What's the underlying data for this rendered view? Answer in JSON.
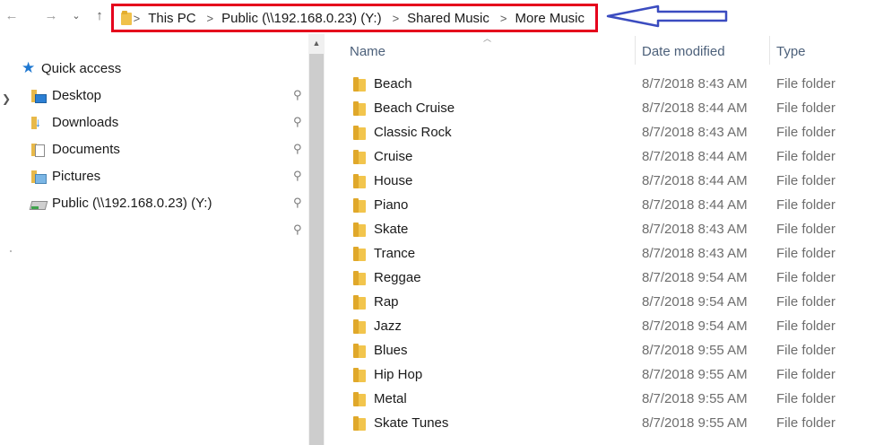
{
  "nav": {
    "back_icon": "←",
    "forward_icon": "→",
    "recent_icon": "⌄",
    "up_icon": "↑"
  },
  "address": {
    "separator": ">",
    "crumbs": [
      "This PC",
      "Public (\\\\192.168.0.23) (Y:)",
      "Shared Music",
      "More Music"
    ]
  },
  "sidebar": {
    "quick_access_label": "Quick access",
    "items": [
      {
        "label": "Desktop",
        "icon": "desktop-folder-icon"
      },
      {
        "label": "Downloads",
        "icon": "downloads-folder-icon"
      },
      {
        "label": "Documents",
        "icon": "documents-folder-icon"
      },
      {
        "label": "Pictures",
        "icon": "pictures-folder-icon"
      },
      {
        "label": "Public (\\\\192.168.0.23) (Y:)",
        "icon": "network-drive-icon"
      }
    ],
    "pin_icon": "📌"
  },
  "columns": {
    "name": "Name",
    "date_modified": "Date modified",
    "type": "Type"
  },
  "files": [
    {
      "name": "Beach",
      "date": "8/7/2018 8:43 AM",
      "type": "File folder"
    },
    {
      "name": "Beach Cruise",
      "date": "8/7/2018 8:44 AM",
      "type": "File folder"
    },
    {
      "name": "Classic Rock",
      "date": "8/7/2018 8:43 AM",
      "type": "File folder"
    },
    {
      "name": "Cruise",
      "date": "8/7/2018 8:44 AM",
      "type": "File folder"
    },
    {
      "name": "House",
      "date": "8/7/2018 8:44 AM",
      "type": "File folder"
    },
    {
      "name": "Piano",
      "date": "8/7/2018 8:44 AM",
      "type": "File folder"
    },
    {
      "name": "Skate",
      "date": "8/7/2018 8:43 AM",
      "type": "File folder"
    },
    {
      "name": "Trance",
      "date": "8/7/2018 8:43 AM",
      "type": "File folder"
    },
    {
      "name": "Reggae",
      "date": "8/7/2018 9:54 AM",
      "type": "File folder"
    },
    {
      "name": "Rap",
      "date": "8/7/2018 9:54 AM",
      "type": "File folder"
    },
    {
      "name": "Jazz",
      "date": "8/7/2018 9:54 AM",
      "type": "File folder"
    },
    {
      "name": "Blues",
      "date": "8/7/2018 9:55 AM",
      "type": "File folder"
    },
    {
      "name": "Hip Hop",
      "date": "8/7/2018 9:55 AM",
      "type": "File folder"
    },
    {
      "name": "Metal",
      "date": "8/7/2018 9:55 AM",
      "type": "File folder"
    },
    {
      "name": "Skate Tunes",
      "date": "8/7/2018 9:55 AM",
      "type": "File folder"
    }
  ],
  "colors": {
    "highlight_box": "#e5001c",
    "annotation_arrow": "#3b4cc0",
    "header_text": "#4c607a",
    "folder": "#f2c54d"
  }
}
